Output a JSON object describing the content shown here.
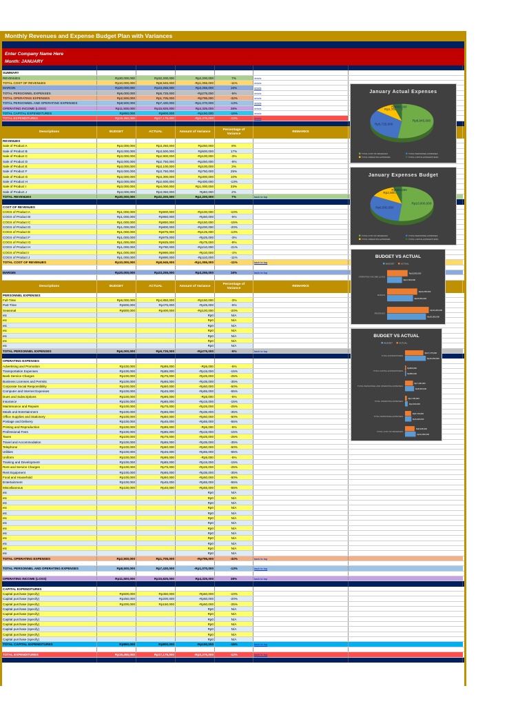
{
  "title": "Monthly Revenues and Expense Budget Plan with Variances",
  "company": "Enter Company Name Here",
  "month": "Month: JANUARY",
  "header": {
    "desc": "Descriptions",
    "budget": "BUDGET",
    "actual": "ACTUAL",
    "variance": "Amount of Variance",
    "pct": "Percentage of Variance",
    "remarks": "REMARKS"
  },
  "colors": {
    "item_a": "#ffff66",
    "item_b": "#ddebf7",
    "navy": "#002060",
    "gold": "#bf9000",
    "red": "#c00000"
  },
  "rows": [
    {
      "t": "nav"
    },
    {
      "t": "lab",
      "d": "SUMMARY"
    },
    {
      "t": "sum",
      "d": "REVENUES",
      "b": "Rp30,000,000",
      "a": "Rp32,200,000",
      "v": "Rp2,200,000",
      "p": "7%",
      "r": "details",
      "c": "#a9d08e"
    },
    {
      "t": "sum",
      "d": "TOTAL COST OF REVENUES",
      "b": "Rp10,000,000",
      "a": "Rp8,945,000",
      "v": "-Rp1,055,000",
      "p": "-11%",
      "r": "details",
      "c": "#ffd966"
    },
    {
      "t": "sum",
      "d": "MARGIN",
      "b": "Rp20,000,000",
      "a": "Rp23,255,000",
      "v": "Rp3,255,000",
      "p": "16%",
      "r": "details",
      "c": "#8ea9db"
    },
    {
      "t": "sum",
      "d": "TOTAL PERSONNEL EXPENSES",
      "b": "Rp6,000,000",
      "a": "Rp5,725,000",
      "v": "-Rp275,000",
      "p": "-5%",
      "r": "details",
      "c": "#c0c0c0"
    },
    {
      "t": "sum",
      "d": "TOTAL OPERATING EXPENSES",
      "b": "Rp2,500,000",
      "a": "Rp1,705,000",
      "v": "-Rp795,000",
      "p": "-32%",
      "r": "details",
      "c": "#f4b084"
    },
    {
      "t": "sum",
      "d": "TOTAL PERSONNEL AND OPERATING EXPENSES",
      "b": "Rp8,500,000",
      "a": "Rp7,430,000",
      "v": "-Rp1,070,000",
      "p": "-13%",
      "r": "details",
      "c": "#9dc3e6"
    },
    {
      "t": "sum",
      "d": "OPERATING INCOME (LOSS)",
      "b": "Rp11,500,000",
      "a": "Rp15,825,000",
      "v": "Rp4,325,000",
      "p": "38%",
      "r": "details",
      "c": "#c5a3e0"
    },
    {
      "t": "sum",
      "d": "TOTAL CAPITAL EXPENDITURES",
      "b": "Rp850,000",
      "a": "Rp800,000",
      "v": "-Rp150,000",
      "p": "-16%",
      "r": "details",
      "c": "#2fc4f2"
    },
    {
      "t": "sum",
      "d": "TOTAL EXPENDITURES",
      "b": "Rp19,450,000",
      "a": "Rp17,175,000",
      "v": "-Rp2,275,000",
      "p": "-12%",
      "r": "details",
      "c": "#ff4d4d",
      "w": true
    },
    {
      "t": "nav"
    },
    {
      "t": "hdr"
    },
    {
      "t": "lab",
      "d": "REVENUES"
    },
    {
      "t": "it",
      "d": "Sale of Product A",
      "b": "Rp3,000,000",
      "a": "Rp3,250,000",
      "v": "Rp250,000",
      "p": "8%"
    },
    {
      "t": "it",
      "d": "Sale of Product B",
      "b": "Rp3,000,000",
      "a": "Rp3,500,000",
      "v": "Rp500,000",
      "p": "17%"
    },
    {
      "t": "it",
      "d": "Sale of Product C",
      "b": "Rp3,000,000",
      "a": "Rp2,900,000",
      "v": "-Rp100,000",
      "p": "-3%"
    },
    {
      "t": "it",
      "d": "Sale of Product D",
      "b": "Rp3,000,000",
      "a": "Rp2,750,000",
      "v": "-Rp250,000",
      "p": "-8%"
    },
    {
      "t": "it",
      "d": "Sale of Product E",
      "b": "Rp3,000,000",
      "a": "Rp3,100,000",
      "v": "Rp100,000",
      "p": "3%"
    },
    {
      "t": "it",
      "d": "Sale of Product F",
      "b": "Rp3,000,000",
      "a": "Rp3,750,000",
      "v": "Rp750,000",
      "p": "25%"
    },
    {
      "t": "it",
      "d": "Sale of Product G",
      "b": "Rp3,000,000",
      "a": "Rp3,300,000",
      "v": "Rp300,000",
      "p": "10%"
    },
    {
      "t": "it",
      "d": "Sale of Product H",
      "b": "Rp3,000,000",
      "a": "Rp2,600,000",
      "v": "-Rp400,000",
      "p": "-13%"
    },
    {
      "t": "it",
      "d": "Sale of Product I",
      "b": "Rp3,000,000",
      "a": "Rp4,000,000",
      "v": "Rp1,000,000",
      "p": "33%"
    },
    {
      "t": "it",
      "d": "Sale of Product J",
      "b": "Rp3,000,000",
      "a": "Rp3,050,000",
      "v": "Rp50,000",
      "p": "2%"
    },
    {
      "t": "tot",
      "d": "TOTAL REVENUES",
      "b": "Rp30,000,000",
      "a": "Rp32,200,000",
      "v": "Rp2,200,000",
      "p": "7%",
      "r": "back to top",
      "c": "#a9d08e"
    },
    {
      "t": "nav"
    },
    {
      "t": "lab",
      "d": "COST OF REVENUES"
    },
    {
      "t": "it",
      "d": "COGS of Product A",
      "b": "Rp1,000,000",
      "a": "Rp900,000",
      "v": "-Rp100,000",
      "p": "-10%"
    },
    {
      "t": "it",
      "d": "COGS of Product B",
      "b": "Rp1,000,000",
      "a": "Rp950,000",
      "v": "-Rp50,000",
      "p": "-5%"
    },
    {
      "t": "it",
      "d": "COGS of Product C",
      "b": "Rp1,000,000",
      "a": "Rp850,000",
      "v": "-Rp150,000",
      "p": "-15%"
    },
    {
      "t": "it",
      "d": "COGS of Product D",
      "b": "Rp1,000,000",
      "a": "Rp800,000",
      "v": "-Rp200,000",
      "p": "-20%"
    },
    {
      "t": "it",
      "d": "COGS of Product E",
      "b": "Rp1,000,000",
      "a": "Rp875,000",
      "v": "-Rp125,000",
      "p": "-13%"
    },
    {
      "t": "it",
      "d": "COGS of Product F",
      "b": "Rp1,000,000",
      "a": "Rp975,000",
      "v": "-Rp25,000",
      "p": "-3%"
    },
    {
      "t": "it",
      "d": "COGS of Product G",
      "b": "Rp1,000,000",
      "a": "Rp925,000",
      "v": "-Rp75,000",
      "p": "-8%"
    },
    {
      "t": "it",
      "d": "COGS of Product H",
      "b": "Rp1,000,000",
      "a": "Rp790,000",
      "v": "-Rp210,000",
      "p": "-21%"
    },
    {
      "t": "it",
      "d": "COGS of Product I",
      "b": "Rp1,000,000",
      "a": "Rp990,000",
      "v": "-Rp10,000",
      "p": "-1%"
    },
    {
      "t": "it",
      "d": "COGS of Product J",
      "b": "Rp1,000,000",
      "a": "Rp890,000",
      "v": "-Rp110,000",
      "p": "-11%"
    },
    {
      "t": "tot",
      "d": "TOTAL COST OF REVENUES",
      "b": "Rp10,000,000",
      "a": "Rp8,945,000",
      "v": "-Rp1,055,000",
      "p": "-11%",
      "r": "back to top",
      "c": "#ffd966"
    },
    {
      "t": "blank"
    },
    {
      "t": "tot",
      "d": "MARGIN",
      "b": "Rp20,000,000",
      "a": "Rp23,255,000",
      "v": "Rp3,255,000",
      "p": "16%",
      "r": "back to top",
      "c": "#8ea9db"
    },
    {
      "t": "blank"
    },
    {
      "t": "hdr"
    },
    {
      "t": "lab",
      "d": "PERSONNEL EXPENSES"
    },
    {
      "t": "it",
      "d": "Full-Time",
      "b": "Rp6,000,000",
      "a": "Rp4,850,000",
      "v": "-Rp150,000",
      "p": "-3%"
    },
    {
      "t": "it",
      "d": "Part-Time",
      "b": "Rp500,000",
      "a": "Rp475,000",
      "v": "-Rp25,000",
      "p": "-5%"
    },
    {
      "t": "it",
      "d": "Seasonal",
      "b": "Rp500,000",
      "a": "Rp400,000",
      "v": "-Rp100,000",
      "p": "-20%"
    },
    {
      "t": "it",
      "d": "etc",
      "v": "Rp0",
      "p": "N/A"
    },
    {
      "t": "it",
      "d": "etc",
      "v": "Rp0",
      "p": "N/A"
    },
    {
      "t": "it",
      "d": "etc",
      "v": "Rp0",
      "p": "N/A"
    },
    {
      "t": "it",
      "d": "etc",
      "v": "Rp0",
      "p": "N/A"
    },
    {
      "t": "it",
      "d": "etc",
      "v": "Rp0",
      "p": "N/A"
    },
    {
      "t": "it",
      "d": "etc",
      "v": "Rp0",
      "p": "N/A"
    },
    {
      "t": "it",
      "d": "etc",
      "v": "Rp0",
      "p": "N/A"
    },
    {
      "t": "tot",
      "d": "TOTAL PERSONNEL EXPENSES",
      "b": "Rp6,000,000",
      "a": "Rp5,725,000",
      "v": "-Rp275,000",
      "p": "-5%",
      "r": "back to top",
      "c": "#c0c0c0"
    },
    {
      "t": "nav"
    },
    {
      "t": "lab",
      "d": "OPERATING EXPENSES"
    },
    {
      "t": "it",
      "d": "Advertising and Promotion",
      "b": "Rp100,000",
      "a": "Rp95,000",
      "v": "-Rp5,000",
      "p": "-5%"
    },
    {
      "t": "it",
      "d": "Transportation Expenses",
      "b": "Rp100,000",
      "a": "Rp85,000",
      "v": "-Rp15,000",
      "p": "-15%"
    },
    {
      "t": "it",
      "d": "Bank Service Charges",
      "b": "Rp100,000",
      "a": "Rp75,000",
      "v": "-Rp25,000",
      "p": "-25%"
    },
    {
      "t": "it",
      "d": "Business Licenses and Permits",
      "b": "Rp100,000",
      "a": "Rp65,000",
      "v": "-Rp35,000",
      "p": "-35%"
    },
    {
      "t": "it",
      "d": "Corporate Social Responsibility",
      "b": "Rp100,000",
      "a": "Rp50,000",
      "v": "-Rp50,000",
      "p": "-50%"
    },
    {
      "t": "it",
      "d": "Computer and Internet Expenses",
      "b": "Rp100,000",
      "a": "Rp45,000",
      "v": "-Rp55,000",
      "p": "-55%"
    },
    {
      "t": "it",
      "d": "Dues and Subscriptions",
      "b": "Rp100,000",
      "a": "Rp95,000",
      "v": "-Rp5,000",
      "p": "-5%"
    },
    {
      "t": "it",
      "d": "Insurance",
      "b": "Rp100,000",
      "a": "Rp85,000",
      "v": "-Rp15,000",
      "p": "-15%"
    },
    {
      "t": "it",
      "d": "Maintenance and Repairs",
      "b": "Rp100,000",
      "a": "Rp75,000",
      "v": "-Rp25,000",
      "p": "-25%"
    },
    {
      "t": "it",
      "d": "Meals and Entertainment",
      "b": "Rp100,000",
      "a": "Rp65,000",
      "v": "-Rp35,000",
      "p": "-35%"
    },
    {
      "t": "it",
      "d": "Office Supplies and Stationery",
      "b": "Rp100,000",
      "a": "Rp50,000",
      "v": "-Rp50,000",
      "p": "-50%"
    },
    {
      "t": "it",
      "d": "Postage and Delivery",
      "b": "Rp100,000",
      "a": "Rp45,000",
      "v": "-Rp55,000",
      "p": "-55%"
    },
    {
      "t": "it",
      "d": "Printing and Reproduction",
      "b": "Rp100,000",
      "a": "Rp95,000",
      "v": "-Rp5,000",
      "p": "-5%"
    },
    {
      "t": "it",
      "d": "Professional Fees",
      "b": "Rp100,000",
      "a": "Rp85,000",
      "v": "-Rp15,000",
      "p": "-15%"
    },
    {
      "t": "it",
      "d": "Taxes",
      "b": "Rp100,000",
      "a": "Rp75,000",
      "v": "-Rp25,000",
      "p": "-25%"
    },
    {
      "t": "it",
      "d": "Travel and Accommodation",
      "b": "Rp100,000",
      "a": "Rp65,000",
      "v": "-Rp35,000",
      "p": "-35%"
    },
    {
      "t": "it",
      "d": "Telephone",
      "b": "Rp100,000",
      "a": "Rp50,000",
      "v": "-Rp50,000",
      "p": "-50%"
    },
    {
      "t": "it",
      "d": "Utilities",
      "b": "Rp100,000",
      "a": "Rp45,000",
      "v": "-Rp55,000",
      "p": "-55%"
    },
    {
      "t": "it",
      "d": "Uniform",
      "b": "Rp100,000",
      "a": "Rp95,000",
      "v": "-Rp5,000",
      "p": "-5%"
    },
    {
      "t": "it",
      "d": "Training and Development",
      "b": "Rp100,000",
      "a": "Rp85,000",
      "v": "-Rp15,000",
      "p": "-15%"
    },
    {
      "t": "it",
      "d": "Rent and Service Charges",
      "b": "Rp100,000",
      "a": "Rp75,000",
      "v": "-Rp25,000",
      "p": "-25%"
    },
    {
      "t": "it",
      "d": "Rent Equipment",
      "b": "Rp100,000",
      "a": "Rp65,000",
      "v": "-Rp35,000",
      "p": "-35%"
    },
    {
      "t": "it",
      "d": "Food and Household",
      "b": "Rp100,000",
      "a": "Rp50,000",
      "v": "-Rp50,000",
      "p": "-50%"
    },
    {
      "t": "it",
      "d": "Entertainment",
      "b": "Rp100,000",
      "a": "Rp45,000",
      "v": "-Rp55,000",
      "p": "-55%"
    },
    {
      "t": "it",
      "d": "Miscellaneous",
      "b": "Rp100,000",
      "a": "Rp45,000",
      "v": "-Rp55,000",
      "p": "-55%"
    },
    {
      "t": "it",
      "d": "etc",
      "v": "Rp0",
      "p": "N/A"
    },
    {
      "t": "it",
      "d": "etc",
      "v": "Rp0",
      "p": "N/A"
    },
    {
      "t": "it",
      "d": "etc",
      "v": "Rp0",
      "p": "N/A"
    },
    {
      "t": "it",
      "d": "etc",
      "v": "Rp0",
      "p": "N/A"
    },
    {
      "t": "it",
      "d": "etc",
      "v": "Rp0",
      "p": "N/A"
    },
    {
      "t": "it",
      "d": "etc",
      "v": "Rp0",
      "p": "N/A"
    },
    {
      "t": "it",
      "d": "etc",
      "v": "Rp0",
      "p": "N/A"
    },
    {
      "t": "it",
      "d": "etc",
      "v": "Rp0",
      "p": "N/A"
    },
    {
      "t": "it",
      "d": "etc",
      "v": "Rp0",
      "p": "N/A"
    },
    {
      "t": "it",
      "d": "etc",
      "v": "Rp0",
      "p": "N/A"
    },
    {
      "t": "it",
      "d": "etc",
      "v": "Rp0",
      "p": "N/A"
    },
    {
      "t": "it",
      "d": "etc",
      "v": "Rp0",
      "p": "N/A"
    },
    {
      "t": "it",
      "d": "etc",
      "v": "Rp0",
      "p": "N/A"
    },
    {
      "t": "tot",
      "d": "TOTAL OPERATING EXPENSES",
      "b": "Rp2,500,000",
      "a": "Rp1,705,000",
      "v": "-Rp795,000",
      "p": "-32%",
      "r": "back to top",
      "c": "#f4b084"
    },
    {
      "t": "blank"
    },
    {
      "t": "tot",
      "d": "TOTAL PERSONNEL AND OPERATING EXPENSES",
      "b": "Rp8,500,000",
      "a": "Rp7,430,000",
      "v": "-Rp1,070,000",
      "p": "-13%",
      "r": "back to top",
      "c": "#9dc3e6"
    },
    {
      "t": "blank"
    },
    {
      "t": "tot",
      "d": "OPERATING INCOME (LOSS)",
      "b": "Rp11,500,000",
      "a": "Rp15,825,000",
      "v": "Rp4,325,000",
      "p": "38%",
      "r": "back to top",
      "c": "#c5a3e0"
    },
    {
      "t": "nav"
    },
    {
      "t": "lab",
      "d": "CAPITAL EXPENDITURES"
    },
    {
      "t": "it",
      "d": "Capital purchase (specify)",
      "b": "Rp500,000",
      "a": "Rp450,000",
      "v": "-Rp50,000",
      "p": "-10%"
    },
    {
      "t": "it",
      "d": "Capital purchase (specify)",
      "b": "Rp250,000",
      "a": "Rp200,000",
      "v": "-Rp50,000",
      "p": "-20%"
    },
    {
      "t": "it",
      "d": "Capital purchase (specify)",
      "b": "Rp200,000",
      "a": "Rp150,000",
      "v": "-Rp50,000",
      "p": "-25%"
    },
    {
      "t": "it",
      "d": "Capital purchase (specify)",
      "v": "Rp0",
      "p": "N/A"
    },
    {
      "t": "it",
      "d": "Capital purchase (specify)",
      "v": "Rp0",
      "p": "N/A"
    },
    {
      "t": "it",
      "d": "Capital purchase (specify)",
      "v": "Rp0",
      "p": "N/A"
    },
    {
      "t": "it",
      "d": "Capital purchase (specify)",
      "v": "Rp0",
      "p": "N/A"
    },
    {
      "t": "it",
      "d": "Capital purchase (specify)",
      "v": "Rp0",
      "p": "N/A"
    },
    {
      "t": "it",
      "d": "Capital purchase (specify)",
      "v": "Rp0",
      "p": "N/A"
    },
    {
      "t": "it",
      "d": "Capital purchase (specify)",
      "v": "Rp0",
      "p": "N/A"
    },
    {
      "t": "tot",
      "d": "TOTAL CAPITAL EXPENDITURES",
      "b": "Rp850,000",
      "a": "Rp800,000",
      "v": "-Rp150,000",
      "p": "-16%",
      "r": "back to top",
      "c": "#00b0f0"
    },
    {
      "t": "blank"
    },
    {
      "t": "tot",
      "d": "TOTAL EXPENDITURES",
      "b": "Rp19,450,000",
      "a": "Rp17,175,000",
      "v": "-Rp2,275,000",
      "p": "-12%",
      "r": "back to top",
      "c": "#ff4d4d",
      "w": true
    },
    {
      "t": "nav"
    }
  ],
  "chart_data": [
    {
      "type": "pie",
      "title": "January Actual Expenses",
      "labels": [
        "TOTAL COST OF REVENUES",
        "TOTAL PERSONNEL EXPENSES",
        "TOTAL OPERATING EXPENSES",
        "TOTAL CAPITAL EXPENDITURES"
      ],
      "values": [
        8945000,
        5725000,
        1705000,
        800000
      ],
      "data_labels": [
        "Rp8,945,000",
        "Rp5,725,000",
        "Rp1,705,000",
        "Rp800,000"
      ],
      "colors": [
        "#70ad47",
        "#4472c4",
        "#ffc000",
        "#38723a"
      ],
      "legend": "bottom"
    },
    {
      "type": "pie",
      "title": "January Expenses Budget",
      "labels": [
        "TOTAL COST OF REVENUES",
        "TOTAL PERSONNEL EXPENSES",
        "TOTAL OPERATING EXPENSES",
        "TOTAL CAPITAL EXPENDITURES"
      ],
      "values": [
        10000000,
        6000000,
        2500000,
        850000
      ],
      "data_labels": [
        "Rp10,000,000",
        "Rp6,000,000",
        "Rp2,500,000",
        "Rp850,000"
      ],
      "colors": [
        "#70ad47",
        "#4472c4",
        "#ffc000",
        "#38723a"
      ],
      "legend": "bottom"
    },
    {
      "type": "bar",
      "title": "BUDGET VS ACTUAL",
      "orientation": "horizontal",
      "legend": "top",
      "categories": [
        "OPERATING INCOME (LOSS)",
        "MARGIN",
        "REVENUES"
      ],
      "series": [
        {
          "name": "BUDGET",
          "color": "#5b9bd5",
          "values": [
            11500000,
            20000000,
            30000000
          ],
          "labels": [
            "Rp11,500,000",
            "Rp20,000,000",
            "Rp30,000,000"
          ]
        },
        {
          "name": "ACTUAL",
          "color": "#ed7d31",
          "values": [
            15825000,
            23255000,
            32200000
          ],
          "labels": [
            "Rp15,825,000",
            "Rp23,255,000",
            "Rp32,200,000"
          ]
        }
      ],
      "xlim": [
        0,
        33000000
      ]
    },
    {
      "type": "bar",
      "title": "BUDGET VS ACTUAL",
      "orientation": "horizontal",
      "legend": "top",
      "categories": [
        "TOTAL EXPENDITURES",
        "TOTAL CAPITAL EXPENDITURES",
        "TOTAL PERSONNEL AND OPERATING EXPENSES",
        "TOTAL OPERATING EXPENSES",
        "TOTAL PERSONNEL EXPENSES",
        "TOTAL COST OF REVENUES"
      ],
      "series": [
        {
          "name": "BUDGET",
          "color": "#5b9bd5",
          "values": [
            19450000,
            850000,
            8500000,
            2500000,
            6000000,
            10000000
          ],
          "labels": [
            "Rp19,450,000",
            "Rp850,000",
            "Rp8,500,000",
            "Rp2,500,000",
            "Rp6,000,000",
            "Rp10,000,000"
          ]
        },
        {
          "name": "ACTUAL",
          "color": "#ed7d31",
          "values": [
            17175000,
            800000,
            7430000,
            1705000,
            5725000,
            8945000
          ],
          "labels": [
            "Rp17,175,000",
            "Rp800,000",
            "Rp7,430,000",
            "Rp1,705,000",
            "Rp5,725,000",
            "Rp8,945,000"
          ]
        }
      ],
      "xlim": [
        0,
        20000000
      ]
    }
  ]
}
